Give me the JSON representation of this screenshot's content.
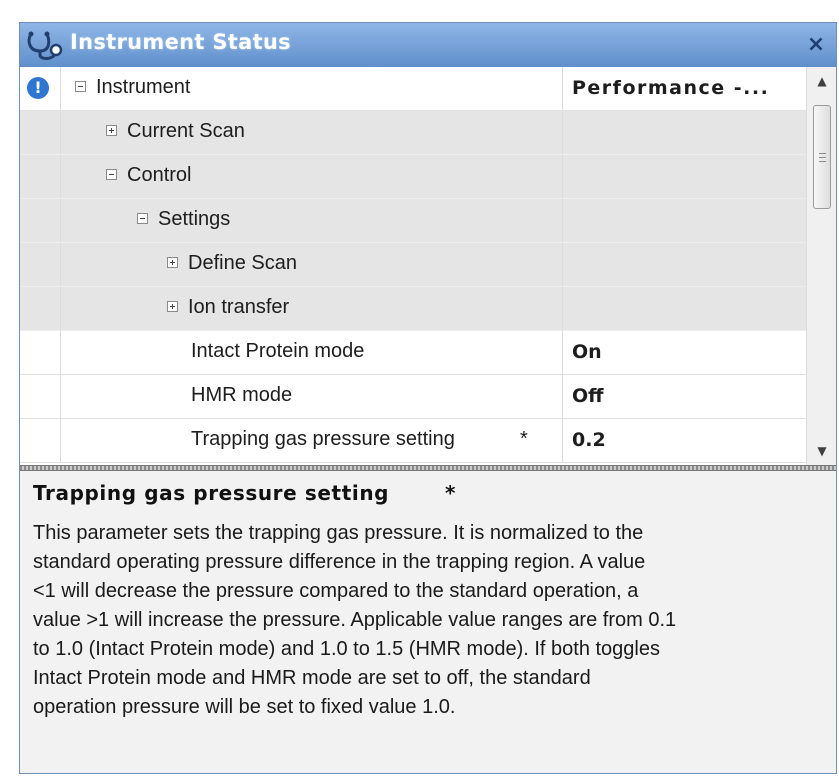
{
  "window": {
    "title": "Instrument Status",
    "close_label": "×"
  },
  "header": {
    "tree_label": "Instrument",
    "column_label": "Performance -..."
  },
  "tree": [
    {
      "label": "Current Scan",
      "expander": "+",
      "value": ""
    },
    {
      "label": "Control",
      "expander": "−",
      "value": ""
    },
    {
      "label": "Settings",
      "expander": "−",
      "value": ""
    },
    {
      "label": "Define Scan",
      "expander": "+",
      "value": ""
    },
    {
      "label": "Ion transfer",
      "expander": "+",
      "value": ""
    },
    {
      "label": "Intact Protein mode",
      "value": "On"
    },
    {
      "label": "HMR mode",
      "value": "Off"
    },
    {
      "label": "Trapping gas pressure setting",
      "marker": "*",
      "value": "0.2"
    }
  ],
  "scrollbar": {
    "up": "▲",
    "down": "▼"
  },
  "description": {
    "title": "Trapping gas pressure setting",
    "marker": "*",
    "lines": [
      "This parameter sets the trapping gas pressure. It is normalized to the",
      "standard operating pressure difference in the trapping region. A value",
      "<1 will decrease the pressure compared to the standard operation, a",
      "value >1 will increase the pressure. Applicable value ranges are from 0.1",
      "to 1.0 (Intact Protein mode) and 1.0 to 1.5 (HMR mode). If both toggles",
      "Intact Protein mode and HMR mode are set to off, the standard",
      "operation pressure will be set to fixed value 1.0."
    ]
  },
  "icons": {
    "title": "stethoscope-icon",
    "info": "info-icon"
  },
  "colors": {
    "title_bar": "#6f9bd6",
    "info": "#2f76d1",
    "selected_rows": "#e5e5e5"
  }
}
